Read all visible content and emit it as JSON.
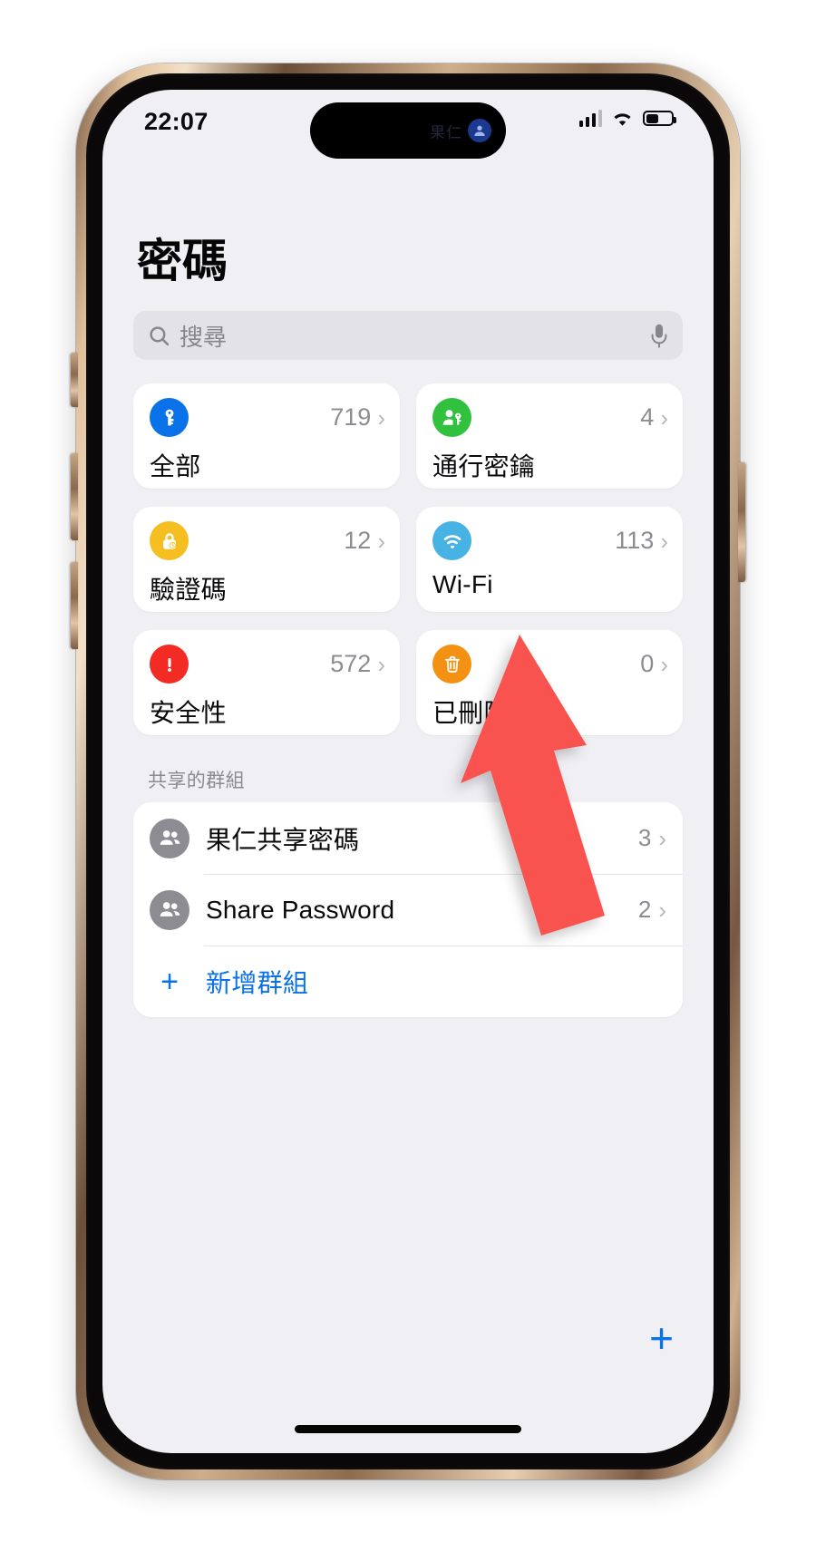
{
  "status_bar": {
    "time": "22:07",
    "dynamic_island_text": "果仁",
    "signal_icon": "cellular-bars-icon",
    "wifi_icon": "wifi-icon",
    "battery_icon": "battery-icon",
    "battery_level_percent": 45
  },
  "header": {
    "title": "密碼"
  },
  "search": {
    "placeholder": "搜尋",
    "value": "",
    "search_icon": "search-icon",
    "mic_icon": "microphone-icon"
  },
  "categories": [
    {
      "label": "全部",
      "count": "719",
      "icon": "key-icon",
      "color": "#0a72e8",
      "chevron": "›"
    },
    {
      "label": "通行密鑰",
      "count": "4",
      "icon": "passkey-icon",
      "color": "#32c13f",
      "chevron": "›"
    },
    {
      "label": "驗證碼",
      "count": "12",
      "icon": "lock-clock-icon",
      "color": "#f5bf22",
      "chevron": "›"
    },
    {
      "label": "Wi-Fi",
      "count": "113",
      "icon": "wifi-circle-icon",
      "color": "#47b2e4",
      "chevron": "›"
    },
    {
      "label": "安全性",
      "count": "572",
      "icon": "warning-icon",
      "color": "#f32b25",
      "chevron": "›"
    },
    {
      "label": "已刪除",
      "count": "0",
      "icon": "trash-icon",
      "color": "#f39212",
      "chevron": "›"
    }
  ],
  "shared_groups": {
    "section_label": "共享的群組",
    "items": [
      {
        "name": "果仁共享密碼",
        "count": "3",
        "icon": "group-avatar-icon",
        "chevron": "›"
      },
      {
        "name": "Share Password",
        "count": "2",
        "icon": "group-avatar-icon",
        "chevron": "›"
      }
    ],
    "add_group": {
      "label": "新增群組",
      "icon": "plus-icon"
    }
  },
  "footer": {
    "add_password_button": "+"
  },
  "annotation": {
    "arrow_color": "#f9534f",
    "points_to": "Wi-Fi"
  },
  "colors": {
    "accent_blue": "#0a72e8",
    "screen_bg": "#f0eff4",
    "card_bg": "#ffffff",
    "secondary_text": "#8c8c93"
  }
}
